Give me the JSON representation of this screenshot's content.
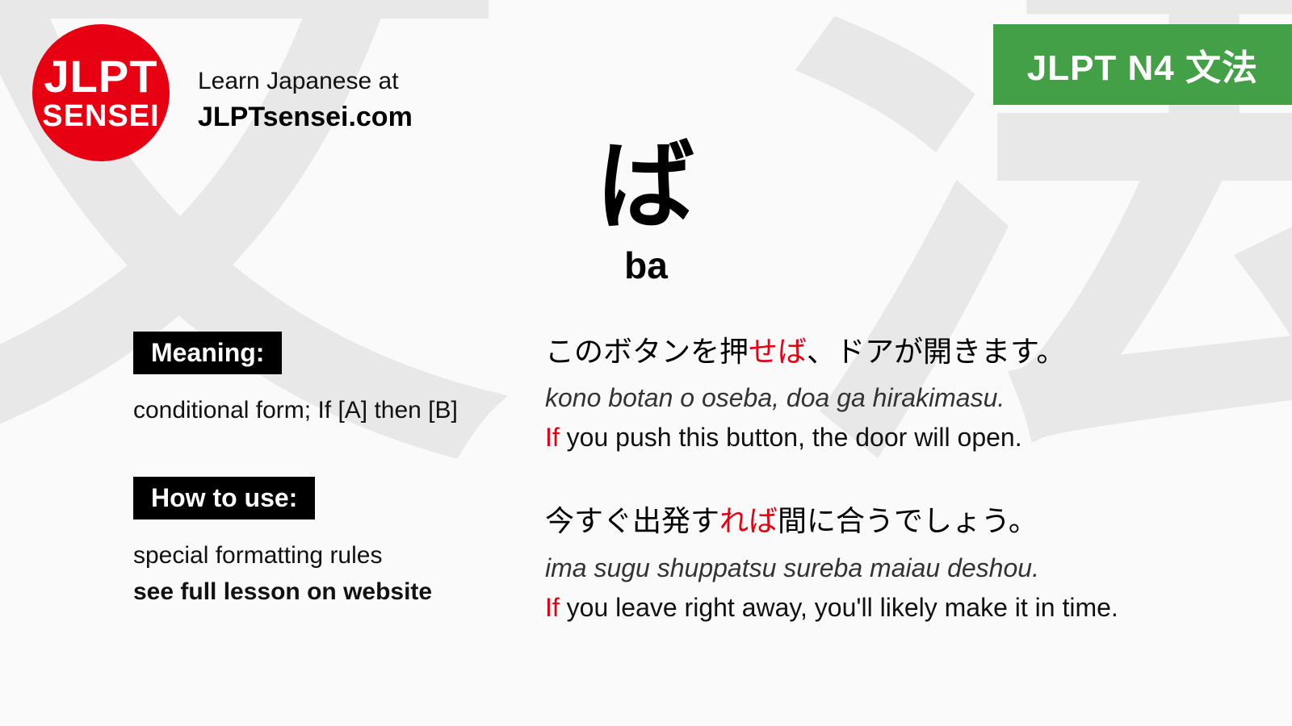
{
  "colors": {
    "accent_red": "#e60012",
    "accent_green": "#43a047"
  },
  "logo": {
    "line1": "JLPT",
    "line2": "SENSEI"
  },
  "header": {
    "tagline": "Learn Japanese at",
    "site": "JLPTsensei.com"
  },
  "badge": "JLPT N4 文法",
  "title": {
    "jp": "ば",
    "romaji": "ba"
  },
  "meaning": {
    "label": "Meaning:",
    "text": "conditional form; If [A] then [B]"
  },
  "howto": {
    "label": "How to use:",
    "line1": "special formatting rules",
    "line2": "see full lesson on website"
  },
  "examples": [
    {
      "jp_pre": "このボタンを押",
      "jp_red": "せば",
      "jp_post": "、ドアが開きます。",
      "romaji": "kono botan o oseba, doa ga hirakimasu.",
      "en_red": "If",
      "en_rest": " you push this button, the door will open."
    },
    {
      "jp_pre": "今すぐ出発す",
      "jp_red": "れば",
      "jp_post": "間に合うでしょう。",
      "romaji": "ima sugu shuppatsu sureba maiau deshou.",
      "en_red": "If",
      "en_rest": " you leave right away, you'll likely make it in time."
    }
  ],
  "bg": {
    "kanji1": "文",
    "kanji2": "法"
  }
}
